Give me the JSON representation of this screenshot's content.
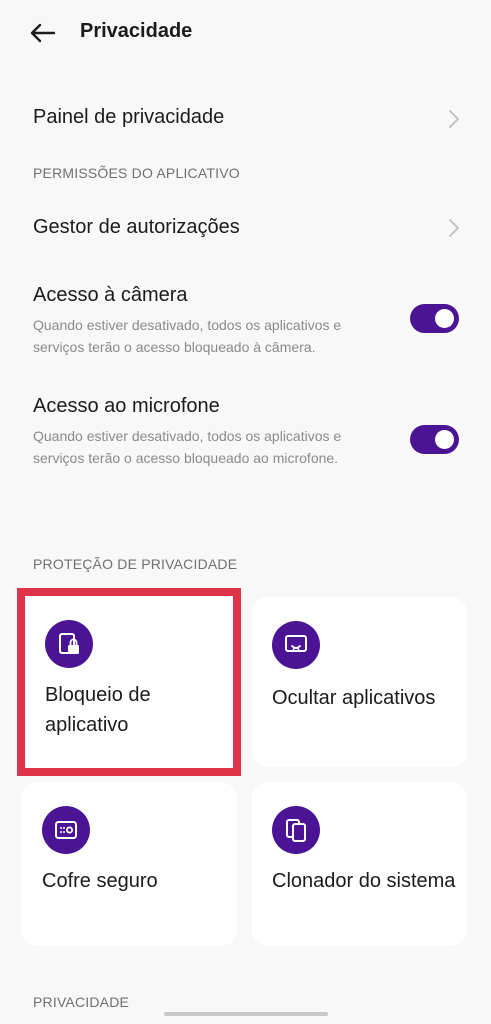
{
  "header": {
    "title": "Privacidade",
    "back_icon": "arrow-left-icon"
  },
  "colors": {
    "accent": "#4a1494",
    "highlight": "#e0344a",
    "background": "#f8f8f8"
  },
  "rows": {
    "privacy_panel": {
      "title": "Painel de privacidade"
    },
    "permissions_section": "PERMISSÕES DO APLICATIVO",
    "permission_manager": {
      "title": "Gestor de autorizações"
    },
    "camera_access": {
      "title": "Acesso à câmera",
      "desc": "Quando estiver desativado, todos os aplicativos e serviços terão o acesso bloqueado à câmera.",
      "enabled": true
    },
    "microphone_access": {
      "title": "Acesso ao microfone",
      "desc": "Quando estiver desativado, todos os aplicativos e serviços terão o acesso bloqueado ao microfone.",
      "enabled": true
    }
  },
  "protection": {
    "section_label": "PROTEÇÃO DE PRIVACIDADE",
    "cards": [
      {
        "label": "Bloqueio de aplicativo",
        "icon": "app-lock-icon"
      },
      {
        "label": "Ocultar aplicativos",
        "icon": "hide-apps-icon"
      },
      {
        "label": "Cofre seguro",
        "icon": "safe-vault-icon"
      },
      {
        "label": "Clonador do sistema",
        "icon": "system-cloner-icon"
      }
    ]
  },
  "privacy_section": "PRIVACIDADE"
}
